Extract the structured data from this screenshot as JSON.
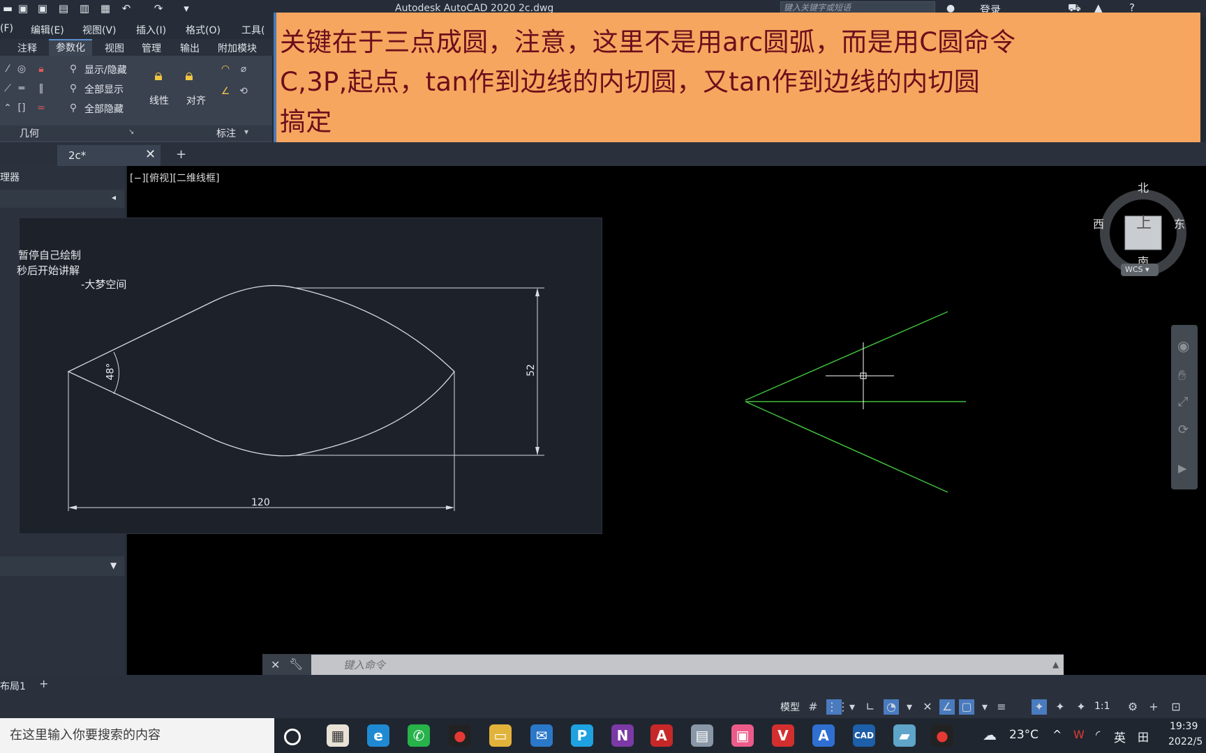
{
  "titlebar": {
    "app_title": "Autodesk AutoCAD 2020    2c.dwg",
    "search_placeholder": "键入关键字或短语",
    "login": "登录"
  },
  "menubar": {
    "items": [
      "(F)",
      "编辑(E)",
      "视图(V)",
      "插入(I)",
      "格式(O)",
      "工具("
    ]
  },
  "ribbon": {
    "tabs": [
      "注释",
      "参数化",
      "视图",
      "管理",
      "输出",
      "附加模块"
    ],
    "active_tab": "参数化",
    "buttons": {
      "show_hide": "显示/隐藏",
      "show_all": "全部显示",
      "hide_all": "全部隐藏",
      "linear": "线性",
      "aligned": "对齐"
    },
    "panels": {
      "geometric": "几何",
      "dimensional": "标注"
    }
  },
  "overlay": {
    "line1": "关键在于三点成圆，注意，这里不是用arc圆弧，而是用C圆命令",
    "line2": "C,3P,起点，tan作到边线的内切圆，又tan作到边线的内切圆",
    "line3": "搞定"
  },
  "doctabs": {
    "current": "2c*"
  },
  "palette": {
    "title": "理器"
  },
  "viewport": {
    "label": "[−][俯视][二维线框]",
    "viewcube": {
      "north": "北",
      "south": "南",
      "east": "东",
      "west": "西",
      "top": "上",
      "wcs": "WCS"
    }
  },
  "reference": {
    "note1": "暂停自己绘制",
    "note2": "秒后开始讲解",
    "note3": "-大梦空间",
    "dim_angle": "48°",
    "dim_height": "52",
    "dim_width": "120"
  },
  "commandline": {
    "placeholder": "键入命令"
  },
  "layout": {
    "tab": "布局1"
  },
  "statusbar": {
    "model": "模型",
    "scale": "1:1"
  },
  "taskbar": {
    "search": "在这里输入你要搜索的内容",
    "weather": "23°C",
    "lang": "英",
    "time": "19:39",
    "date": "2022/5"
  },
  "colors": {
    "overlay_bg": "#f7a65f",
    "overlay_text": "#6a0f1c",
    "green_lines": "#3fbf3a"
  }
}
